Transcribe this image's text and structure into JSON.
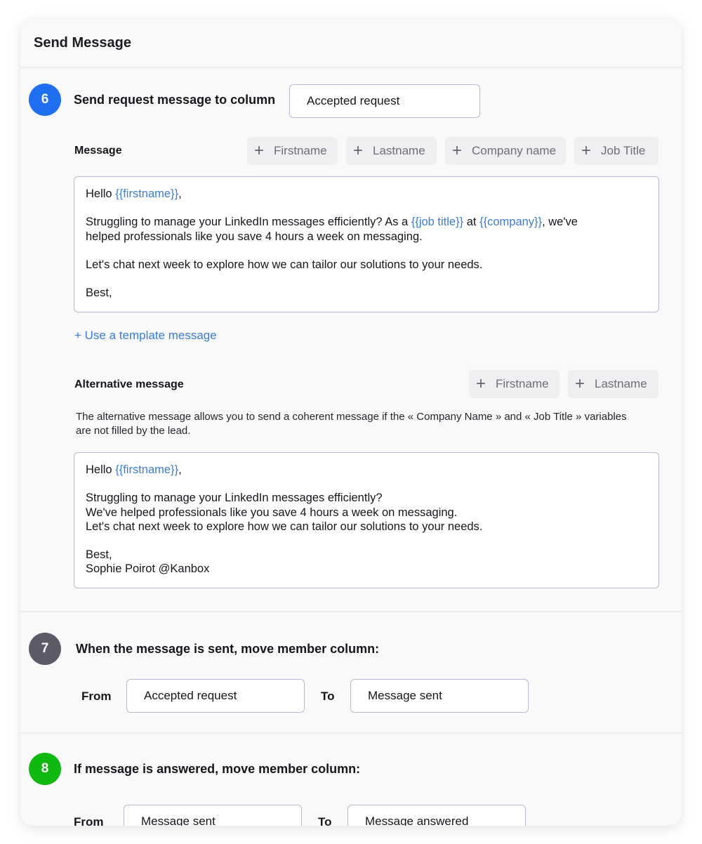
{
  "card": {
    "title": "Send Message"
  },
  "colors": {
    "step6": "#1f6ff0",
    "step7": "#5b5b68",
    "step8": "#10b910",
    "variable": "#3a7cd7"
  },
  "step6": {
    "number": "6",
    "title": "Send request message to column",
    "column_value": "Accepted request",
    "message": {
      "label": "Message",
      "chips": [
        "Firstname",
        "Lastname",
        "Company name",
        "Job Title"
      ],
      "line1": {
        "prefix": "Hello ",
        "var": "{{firstname}}",
        "suffix": ","
      },
      "line2": {
        "a": "Struggling to manage your LinkedIn messages efficiently? As a ",
        "var1": "{{job title}}",
        "b": " at ",
        "var2": "{{company}}",
        "c": ", we've"
      },
      "line3": "helped professionals like you save 4 hours a week on messaging.",
      "line4": "Let's chat next week to explore how we can tailor our solutions to your needs.",
      "line5": "Best,"
    },
    "template_link": "+ Use a template message",
    "alternative": {
      "label": "Alternative message",
      "chips": [
        "Firstname",
        "Lastname"
      ],
      "help_line1": "The alternative message allows you to send a coherent message if the « Company Name » and « Job Title » variables",
      "help_line2": "are not filled by the lead.",
      "line1": {
        "prefix": "Hello ",
        "var": "{{firstname}}",
        "suffix": ","
      },
      "line2": "Struggling to manage your LinkedIn messages efficiently?",
      "line3": "We've helped professionals like you save 4 hours a week on messaging.",
      "line4": "Let's chat next week to explore how we can tailor our solutions to your needs.",
      "line5": "Best,",
      "line6": "Sophie Poirot @Kanbox"
    }
  },
  "step7": {
    "number": "7",
    "title": "When the message is sent, move member column:",
    "from_label": "From",
    "from_value": "Accepted request",
    "to_label": "To",
    "to_value": "Message sent"
  },
  "step8": {
    "number": "8",
    "title": "If message is answered, move member column:",
    "from_label": "From",
    "from_value": "Message sent",
    "to_label": "To",
    "to_value": "Message answered"
  },
  "icons": {
    "chip_plus": "+"
  }
}
